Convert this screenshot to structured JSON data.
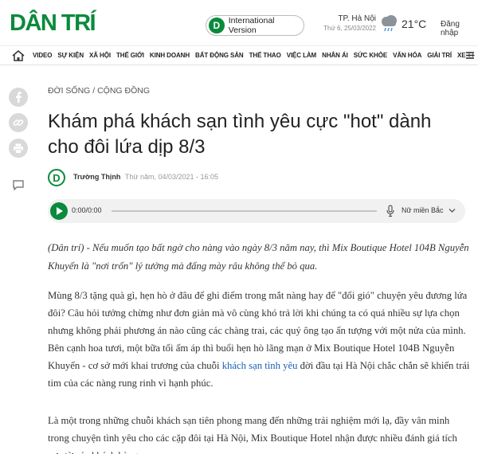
{
  "header": {
    "logo": "DÂN TRÍ",
    "intl_badge": "D",
    "intl_label": "International Version",
    "city": "TP. Hà Nội",
    "date": "Thứ 6, 25/03/2022",
    "weather_icon": "cloud-rain-icon",
    "temperature": "21°C",
    "login": "Đăng nhập"
  },
  "nav": {
    "items": [
      "VIDEO",
      "SỰ KIỆN",
      "XÃ HỘI",
      "THẾ GIỚI",
      "KINH DOANH",
      "BẤT ĐỘNG SẢN",
      "THỂ THAO",
      "VIỆC LÀM",
      "NHÂN ÁI",
      "SỨC KHỎE",
      "VĂN HÓA",
      "GIẢI TRÍ",
      "XE ++"
    ]
  },
  "article": {
    "category": "ĐỜI SỐNG / CỘNG ĐỒNG",
    "title": "Khám phá khách sạn tình yêu cực \"hot\" dành cho đôi lứa dịp 8/3",
    "author_badge": "D",
    "author": "Trường Thịnh",
    "published": "Thứ năm, 04/03/2021 - 16:05",
    "lead": "(Dân trí) - Nếu muốn tạo bất ngờ cho nàng vào ngày 8/3 năm nay, thì Mix Boutique Hotel 104B Nguyễn Khuyến là \"nơi trốn\" lý tưởng mà đấng mày râu không thể bỏ qua.",
    "para1_before": "Mùng 8/3 tặng quà gì, hẹn hò ở đâu để ghi điểm trong mắt nàng hay để \"đổi gió\" chuyện yêu đương lứa đôi? Câu hỏi tưởng chừng như đơn giản mà vô cùng khó trả lời khi chúng ta có quá nhiều sự lựa chọn nhưng không phải phương án nào cũng các chàng trai, các quý ông tạo ấn tượng với một nửa của mình. Bên cạnh hoa tươi, một bữa tối ấm áp thì buổi hẹn hò lãng mạn ở Mix Boutique Hotel 104B Nguyễn Khuyến - cơ sở mới khai trương của chuỗi ",
    "para1_link": "khách sạn tình yêu",
    "para1_after": " đời đầu tại Hà Nội chắc chắn sẽ khiến trái tim của các nàng rung rinh vì hạnh phúc.",
    "para2": "Là một trong những chuỗi khách sạn tiên phong mang đến những trải nghiệm mới lạ, đầy vân minh trong chuyện tình yêu cho các cặp đôi tại Hà Nội, Mix Boutique Hotel nhận được nhiều đánh giá tích cực từ các khách hàng."
  },
  "player": {
    "time": "0:00/0:00",
    "voice": "Nữ miền Bắc"
  }
}
